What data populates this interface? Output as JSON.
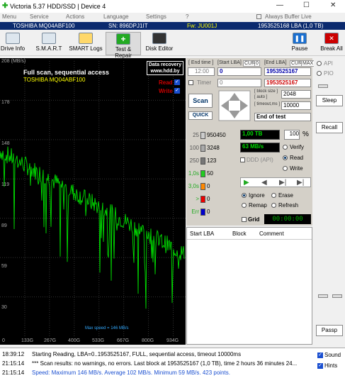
{
  "window": {
    "title": "Victoria 5.37 HDD/SSD | Device 4",
    "minimize": "—",
    "maximize": "☐",
    "close": "✕"
  },
  "menu": [
    "Menu",
    "Service",
    "Actions",
    "Language",
    "Settings",
    "?",
    "Always Buffer Live"
  ],
  "drive": {
    "model": "TOSHIBA MQ04ABF100",
    "serial": "SN: 896DPJ1IT",
    "firmware": "Fw: JU001J",
    "capacity": "1953525168 LBA (1,0 TB)"
  },
  "toolbar": {
    "buttons": [
      {
        "label": "Drive Info",
        "icon": "drive-icon"
      },
      {
        "label": "S.M.A.R.T",
        "icon": "smart-icon"
      },
      {
        "label": "SMART Logs",
        "icon": "folder-icon"
      },
      {
        "label": "Test & Repair",
        "icon": "plus-icon"
      },
      {
        "label": "Disk Editor",
        "icon": "binary-icon"
      }
    ],
    "pause": "Pause",
    "break_all": "Break All"
  },
  "graph": {
    "y_unit": "208 (MB/s)",
    "y_ticks": [
      "178",
      "148",
      "119",
      "89",
      "59",
      "30"
    ],
    "x_ticks": [
      "0",
      "133G",
      "267G",
      "400G",
      "533G",
      "667G",
      "800G",
      "934G"
    ],
    "title": "Full scan, sequential access",
    "subtitle": "TOSHIBA MQ04ABF100",
    "data_recovery": [
      "Data recovery",
      "www.hdd.by"
    ],
    "read_label": "Read",
    "write_label": "Write",
    "max_speed": "Max speed = 146 MB/s",
    "colors": {
      "line": "#00dd00",
      "background": "#000000"
    }
  },
  "controls": {
    "end_time_label": "[ End time ]",
    "start_lba_label": "[Start LBA]",
    "cur_label": "CUR",
    "zero_label": "0",
    "end_lba_label": "[End LBA]",
    "max_label": "MAX",
    "time_value": "12:00",
    "start_lba": "0",
    "end_lba": "1953525167",
    "timer_label": "Timer",
    "timer_value": "0",
    "cur_lba": "1953525167",
    "block_size_label": "[ block size ]",
    "auto_label": "[ auto ]",
    "block_size": "2048",
    "timeout_label": "[ timeout,ms ]",
    "timeout": "10000",
    "scan": "Scan",
    "quick": "QUICK",
    "end_mode": "End of test"
  },
  "stats": {
    "rows": [
      {
        "ms": "25",
        "count": "950450",
        "color": "#cccccc"
      },
      {
        "ms": "100",
        "count": "3248",
        "color": "#aaaaaa"
      },
      {
        "ms": "250",
        "count": "123",
        "color": "#777777"
      },
      {
        "ms": "1,0s",
        "count": "50",
        "color": "#22cc22"
      },
      {
        "ms": "3,0s",
        "count": "0",
        "color": "#ff8800"
      },
      {
        "ms": ">",
        "count": "0",
        "color": "#ee0000"
      },
      {
        "ms": "Err",
        "count": "0",
        "color": "#0000cc"
      }
    ],
    "size": "1,00 TB",
    "percent": "100",
    "percent_unit": "%",
    "speed": "63 MB/s",
    "ddd": "DDD (API)",
    "verify": "Verify",
    "read": "Read",
    "write": "Write",
    "ignore": "Ignore",
    "erase": "Erase",
    "remap": "Remap",
    "refresh": "Refresh",
    "grid": "Grid",
    "timer_display": "00:00:00"
  },
  "table": {
    "columns": [
      "Start LBA",
      "Block",
      "Comment"
    ]
  },
  "right": {
    "api": "API",
    "pio": "PIO",
    "sleep": "Sleep",
    "recall": "Recall",
    "passp": "Passp"
  },
  "log": [
    {
      "time": "18:39:12",
      "text": "Starting Reading, LBA=0..1953525167, FULL, sequential access, timeout 10000ms",
      "color": "#000000"
    },
    {
      "time": "21:15:14",
      "text": "*** Scan results: no warnings, no errors. Last block at 1953525167 (1,0 TB), time 2 hours 36 minutes 24...",
      "color": "#000000"
    },
    {
      "time": "21:15:14",
      "text": "Speed: Maximum 146 MB/s. Average 102 MB/s. Minimum 59 MB/s. 423 points.",
      "color": "#1a4fd0"
    }
  ],
  "log_opts": {
    "sound": "Sound",
    "hints": "Hints"
  }
}
